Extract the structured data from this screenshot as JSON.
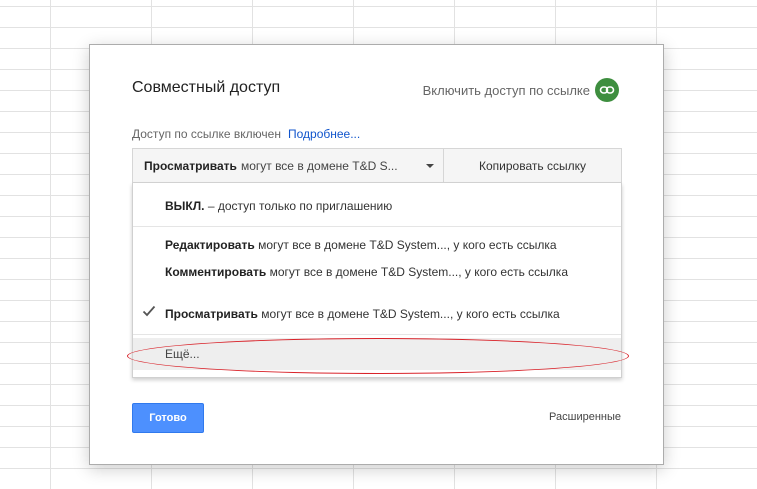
{
  "dialog": {
    "title": "Совместный доступ",
    "link_share_label": "Включить доступ по ссылке",
    "access_status": "Доступ по ссылке включен",
    "more_link": "Подробнее...",
    "permission_select": {
      "strong": "Просматривать",
      "rest": "могут все в домене T&D S..."
    },
    "copy_button": "Копировать ссылку",
    "menu": {
      "items": [
        {
          "strong": "ВЫКЛ.",
          "rest": " – доступ только по приглашению"
        },
        {
          "strong": "Редактировать",
          "rest": " могут все в домене T&D System..., у кого есть ссылка"
        },
        {
          "strong": "Комментировать",
          "rest": " могут все в домене T&D System..., у кого есть ссылка"
        },
        {
          "strong": "Просматривать",
          "rest": " могут все в домене T&D System..., у кого есть ссылка"
        }
      ],
      "more": "Ещё..."
    },
    "done_button": "Готово",
    "advanced": "Расширенные"
  },
  "colors": {
    "link_icon_bg": "#3e8e3f",
    "primary_button": "#4d90fe",
    "link": "#1155cc",
    "highlight": "#d9232a"
  },
  "icons": [
    "link-icon",
    "dropdown-caret-icon",
    "checkmark-icon"
  ]
}
